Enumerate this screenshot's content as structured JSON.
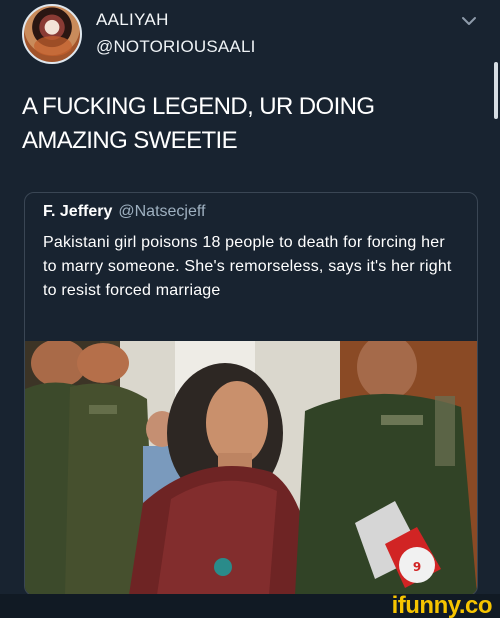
{
  "post": {
    "display_name": "AALIYAH",
    "handle": "@NOTORIOUSAALI",
    "text": "A FUCKING LEGEND, UR DOING AMAZING SWEETIE"
  },
  "quoted_tweet": {
    "name": "F. Jeffery",
    "handle": "@Natsecjeff",
    "text": "Pakistani girl poisons 18 people to death for forcing her to marry someone. She's remorseless, says it's her right to resist forced marriage"
  },
  "icons": {
    "menu": "chevron-down-icon",
    "photo": "news-photo"
  },
  "watermark": {
    "label": "ifunny.co"
  },
  "colors": {
    "background": "#182330",
    "text": "#ffffff",
    "muted": "#9eb0c0",
    "brand": "#f6c400"
  }
}
